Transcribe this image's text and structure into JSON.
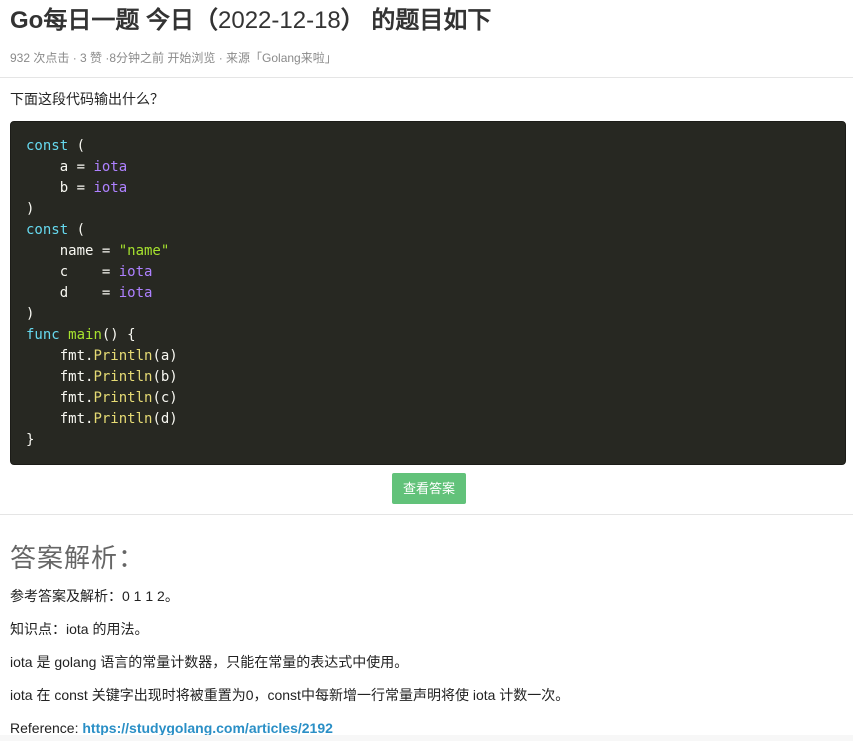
{
  "header": {
    "title_prefix": "Go每日一题 今日（",
    "title_date": "2022-12-18",
    "title_suffix": "） 的题目如下",
    "meta": "932 次点击 · 3 赞 ·8分钟之前 开始浏览   · 来源「Golang来啦」"
  },
  "question": {
    "prompt": "下面这段代码输出什么？"
  },
  "code": {
    "language": "go",
    "lines": [
      [
        {
          "t": "kw",
          "v": "const"
        },
        {
          "t": "ident",
          "v": " ("
        }
      ],
      [
        {
          "t": "ident",
          "v": "    a = "
        },
        {
          "t": "builtin",
          "v": "iota"
        }
      ],
      [
        {
          "t": "ident",
          "v": "    b = "
        },
        {
          "t": "builtin",
          "v": "iota"
        }
      ],
      [
        {
          "t": "ident",
          "v": ")"
        }
      ],
      [
        {
          "t": "kw",
          "v": "const"
        },
        {
          "t": "ident",
          "v": " ("
        }
      ],
      [
        {
          "t": "ident",
          "v": "    name = "
        },
        {
          "t": "strgreen",
          "v": "\"name\""
        }
      ],
      [
        {
          "t": "ident",
          "v": "    c    = "
        },
        {
          "t": "builtin",
          "v": "iota"
        }
      ],
      [
        {
          "t": "ident",
          "v": "    d    = "
        },
        {
          "t": "builtin",
          "v": "iota"
        }
      ],
      [
        {
          "t": "ident",
          "v": ")"
        }
      ],
      [
        {
          "t": "kw",
          "v": "func"
        },
        {
          "t": "ident",
          "v": " "
        },
        {
          "t": "main",
          "v": "main"
        },
        {
          "t": "ident",
          "v": "() {"
        }
      ],
      [
        {
          "t": "ident",
          "v": "    fmt."
        },
        {
          "t": "fn",
          "v": "Println"
        },
        {
          "t": "ident",
          "v": "(a)"
        }
      ],
      [
        {
          "t": "ident",
          "v": "    fmt."
        },
        {
          "t": "fn",
          "v": "Println"
        },
        {
          "t": "ident",
          "v": "(b)"
        }
      ],
      [
        {
          "t": "ident",
          "v": "    fmt."
        },
        {
          "t": "fn",
          "v": "Println"
        },
        {
          "t": "ident",
          "v": "(c)"
        }
      ],
      [
        {
          "t": "ident",
          "v": "    fmt."
        },
        {
          "t": "fn",
          "v": "Println"
        },
        {
          "t": "ident",
          "v": "(d)"
        }
      ],
      [
        {
          "t": "ident",
          "v": "}"
        }
      ]
    ],
    "background": "#272822"
  },
  "answer_button": {
    "label": "查看答案",
    "color": "#62c27a"
  },
  "answer": {
    "heading": "答案解析：",
    "para1": "参考答案及解析：0 1 1 2。",
    "para2": "知识点：iota 的用法。",
    "para3": "iota 是 golang 语言的常量计数器，只能在常量的表达式中使用。",
    "para4": "iota 在 const 关键字出现时将被重置为0，const中每新增一行常量声明将使 iota 计数一次。",
    "reference_label": "Reference: ",
    "reference_link": "https://studygolang.com/articles/2192",
    "link_color": "#2a8fc6"
  }
}
